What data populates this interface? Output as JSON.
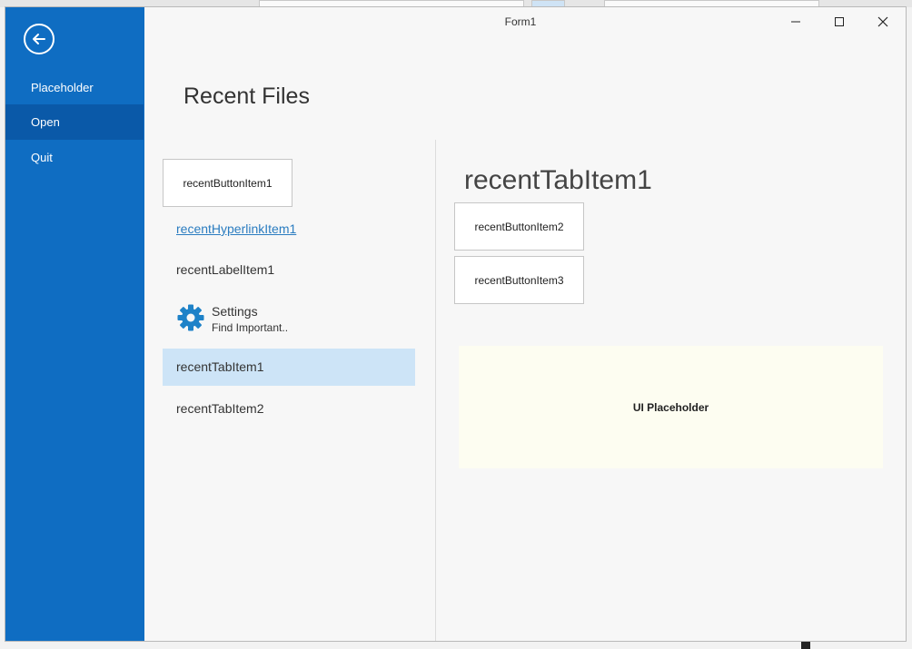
{
  "window": {
    "title": "Form1"
  },
  "sidebar": {
    "items": [
      {
        "label": "Placeholder",
        "active": false
      },
      {
        "label": "Open",
        "active": true
      },
      {
        "label": "Quit",
        "active": false
      }
    ]
  },
  "content": {
    "title": "Recent Files",
    "left_panel": {
      "button_item": "recentButtonItem1",
      "hyperlink_item": "recentHyperlinkItem1",
      "label_item": "recentLabelItem1",
      "settings": {
        "title": "Settings",
        "description": "Find Important.."
      },
      "tabs": [
        {
          "label": "recentTabItem1",
          "selected": true
        },
        {
          "label": "recentTabItem2",
          "selected": false
        }
      ]
    },
    "right_panel": {
      "tab_heading": "recentTabItem1",
      "buttons": [
        "recentButtonItem2",
        "recentButtonItem3"
      ],
      "placeholder": "UI Placeholder"
    }
  },
  "icons": {
    "back": "back-arrow-icon",
    "settings": "gear-icon",
    "minimize": "minimize-icon",
    "maximize": "maximize-icon",
    "close": "close-icon"
  },
  "colors": {
    "sidebar": "#0f6dc2",
    "sidebar_active": "#0a59a8",
    "selected_tab": "#cde4f7",
    "link": "#2a7cc0",
    "placeholder_bg": "#fdfdf1",
    "gear": "#1e82c8"
  }
}
